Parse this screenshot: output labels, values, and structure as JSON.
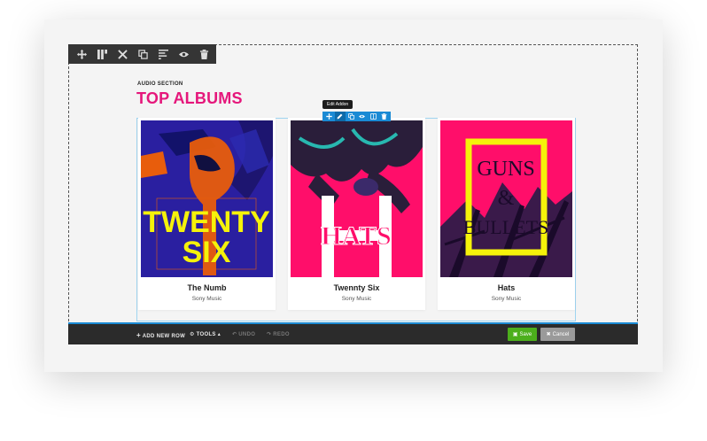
{
  "row_toolbar": {
    "icons": [
      "move-icon",
      "columns-icon",
      "wrench-icon",
      "duplicate-icon",
      "align-icon",
      "eye-icon",
      "trash-icon"
    ]
  },
  "section": {
    "kicker": "AUDIO SECTION",
    "title": "TOP ALBUMS"
  },
  "addon": {
    "tooltip": "Edit Addon",
    "toolbar_icons": [
      "move-icon",
      "pencil-icon",
      "duplicate-icon",
      "eye-icon",
      "columns-icon",
      "trash-icon"
    ]
  },
  "albums": [
    {
      "name": "The Numb",
      "label": "Sony Music",
      "cover_text": [
        "TWENTY",
        "SIX"
      ],
      "bg": "#2a1fa0",
      "accent": "#f5f20a"
    },
    {
      "name": "Twennty Six",
      "label": "Sony Music",
      "cover_text": [
        "HATS"
      ],
      "bg": "#ff0e6a",
      "accent": "#ffffff"
    },
    {
      "name": "Hats",
      "label": "Sony Music",
      "cover_text": [
        "GUNS",
        "&",
        "BULLETS"
      ],
      "bg": "#ff0e6a",
      "accent": "#f5f20a"
    }
  ],
  "bottom_bar": {
    "add_new_row": "ADD NEW ROW",
    "tools": "TOOLS",
    "undo": "UNDO",
    "redo": "REDO",
    "save": "Save",
    "cancel": "Cancel"
  },
  "colors": {
    "brand_pink": "#e5177b",
    "editor_blue": "#1a8ad4",
    "save_green": "#4caf1c"
  }
}
